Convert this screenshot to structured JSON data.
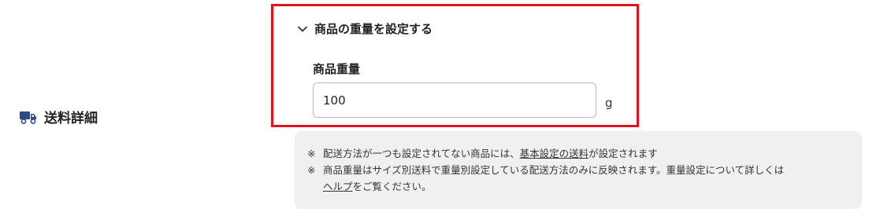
{
  "section": {
    "title": "送料詳細",
    "icon": "truck-icon",
    "icon_color": "#2b4a8a"
  },
  "weight_settings": {
    "accordion_title": "商品の重量を設定する",
    "accordion_icon": "chevron-down-icon",
    "expanded": true,
    "highlight_color": "#e0141e",
    "field_label": "商品重量",
    "value": "100",
    "unit": "g"
  },
  "notes": {
    "mark": "※",
    "line1": {
      "prefix": "配送方法が一つも設定されてない商品には、",
      "link": "基本設定の送料",
      "suffix": "が設定されます"
    },
    "line2": {
      "text": "商品重量はサイズ別送料で重量別設定している配送方法のみに反映されます。重量設定について詳しくは",
      "link": "ヘルプ",
      "suffix": "をご覧ください。"
    }
  }
}
